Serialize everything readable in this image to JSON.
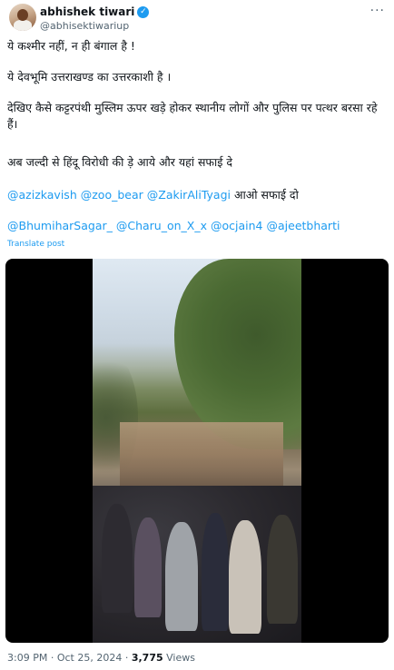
{
  "author": {
    "name": "abhishek tiwari",
    "handle": "@abhisektiwariup",
    "verified_glyph": "✓",
    "more_glyph": "···"
  },
  "tweet": {
    "line1": "ये कश्मीर नहीं, न ही बंगाल है !",
    "line2": "ये देवभूमि उत्तराखण्ड का उत्तरकाशी है ।",
    "line3": "देखिए कैसे कट्टरपंथी मुस्लिम ऊपर खड़े होकर स्थानीय लोगों और पुलिस पर पत्थर बरसा रहे हैं।",
    "line4": "अब जल्दी से हिंदू विरोधी की ड़े आये और यहां सफाई दे",
    "line5": {
      "mentions": [
        "@azizkavish",
        "@zoo_bear",
        "@ZakirAliTyagi"
      ],
      "suffix": " आओ सफाई दो"
    },
    "line6": {
      "mentions": [
        "@BhumiharSagar_",
        "@Charu_on_X_x",
        "@ocjain4",
        "@ajeetbharti"
      ]
    },
    "translate_label": "Translate post"
  },
  "meta": {
    "time": "3:09 PM",
    "separator": " · ",
    "date": "Oct 25, 2024",
    "views_count": "3,775",
    "views_label": " Views"
  },
  "colors": {
    "link": "#1d9bf0",
    "text": "#0f1419",
    "muted": "#536471"
  },
  "icons": [
    "verified-badge-icon",
    "more-options-icon"
  ]
}
